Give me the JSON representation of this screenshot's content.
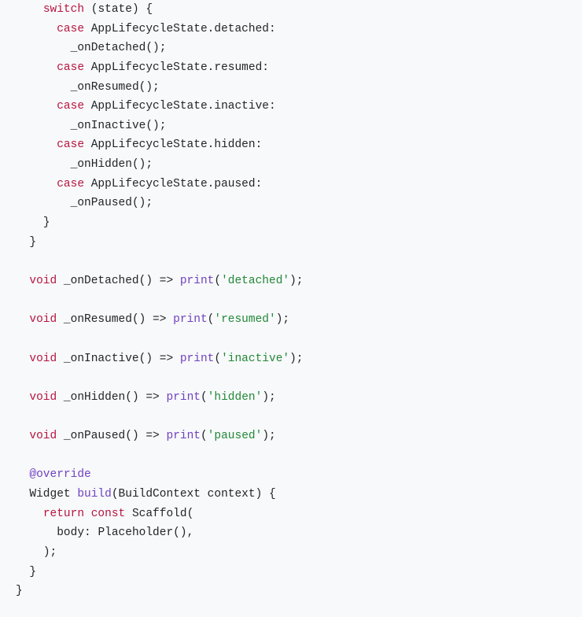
{
  "code": {
    "kw_switch": "switch",
    "kw_case": "case",
    "kw_void": "void",
    "kw_return": "return",
    "kw_const": "const",
    "p_open": "(",
    "p_close": ")",
    "br_open": "{",
    "br_close": "}",
    "semi": ";",
    "colon": ":",
    "arrow": "=>",
    "dot": ".",
    "comma": ",",
    "id_state": "state",
    "cls_als": "AppLifecycleState",
    "enum_detached": "detached",
    "enum_resumed": "resumed",
    "enum_inactive": "inactive",
    "enum_hidden": "hidden",
    "enum_paused": "paused",
    "m_onDetached": "_onDetached",
    "m_onResumed": "_onResumed",
    "m_onInactive": "_onInactive",
    "m_onHidden": "_onHidden",
    "m_onPaused": "_onPaused",
    "fn_print": "print",
    "str_detached": "'detached'",
    "str_resumed": "'resumed'",
    "str_inactive": "'inactive'",
    "str_hidden": "'hidden'",
    "str_paused": "'paused'",
    "at_override": "@override",
    "cls_Widget": "Widget",
    "fn_build": "build",
    "cls_BuildContext": "BuildContext",
    "id_context": "context",
    "cls_Scaffold": "Scaffold",
    "id_body": "body",
    "cls_Placeholder": "Placeholder"
  }
}
